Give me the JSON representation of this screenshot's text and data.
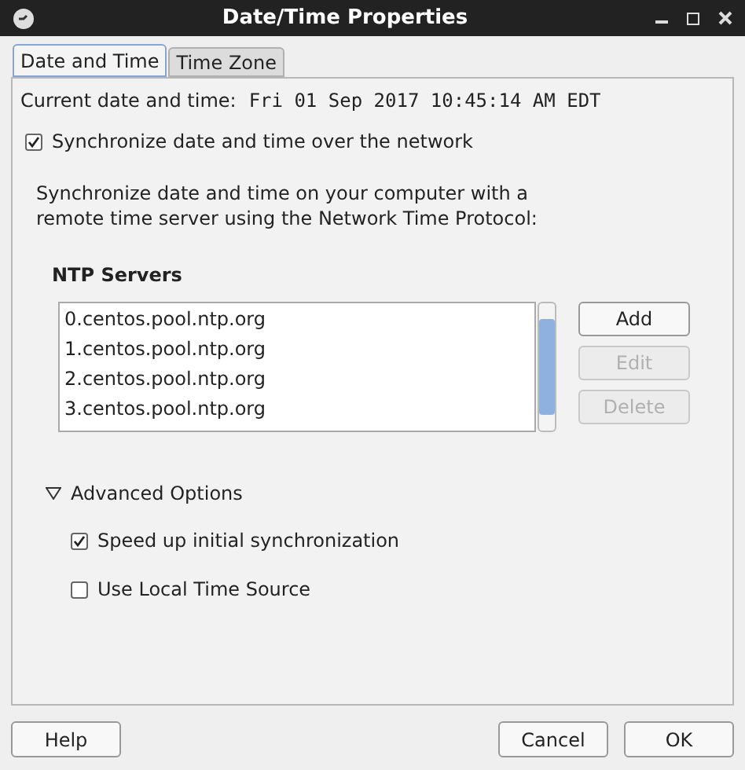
{
  "window": {
    "title": "Date/Time Properties"
  },
  "tabs": [
    {
      "label": "Date and Time",
      "selected": true
    },
    {
      "label": "Time Zone",
      "selected": false
    }
  ],
  "current_time": {
    "label": "Current date and time:",
    "value": "Fri 01 Sep 2017 10:45:14 AM EDT"
  },
  "sync": {
    "label": "Synchronize date and time over the network",
    "checked": true
  },
  "description": "Synchronize date and time on your computer with a remote time server using the Network Time Protocol:",
  "ntp": {
    "heading": "NTP Servers",
    "servers": [
      "0.centos.pool.ntp.org",
      "1.centos.pool.ntp.org",
      "2.centos.pool.ntp.org",
      "3.centos.pool.ntp.org"
    ],
    "buttons": [
      {
        "label": "Add",
        "disabled": false
      },
      {
        "label": "Edit",
        "disabled": true
      },
      {
        "label": "Delete",
        "disabled": true
      }
    ]
  },
  "advanced": {
    "label": "Advanced Options",
    "expanded": true,
    "options": [
      {
        "label": "Speed up initial synchronization",
        "checked": true
      },
      {
        "label": "Use Local Time Source",
        "checked": false
      }
    ]
  },
  "footer": {
    "left": [
      "Help"
    ],
    "right": [
      "Cancel",
      "OK"
    ]
  }
}
